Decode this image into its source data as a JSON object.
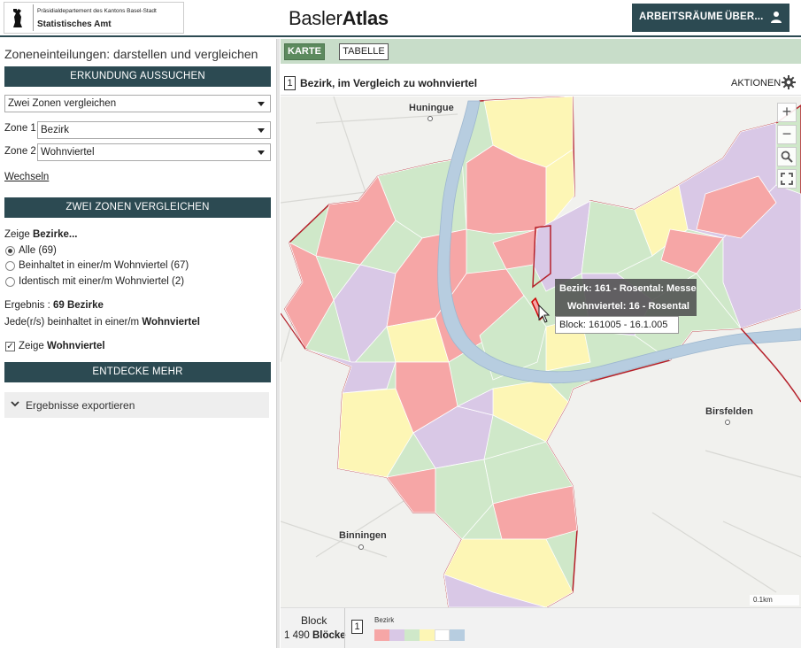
{
  "header": {
    "dept": "Präsidialdepartement des Kantons Basel-Stadt",
    "office": "Statistisches Amt",
    "brand_light": "Basler",
    "brand_bold": "Atlas",
    "nav_workspaces": "ARBEITSRÄUME",
    "nav_about": "ÜBER..."
  },
  "sidebar": {
    "title": "Zoneneinteilungen: darstellen und vergleichen",
    "explore_bar": "ERKUNDUNG AUSSUCHEN",
    "mode_select": "Zwei Zonen vergleichen",
    "zone1_label": "Zone 1",
    "zone1_value": "Bezirk",
    "zone2_label": "Zone 2",
    "zone2_value": "Wohnviertel",
    "swap_link": "Wechseln",
    "compare_bar": "ZWEI ZONEN VERGLEICHEN",
    "show_prefix": "Zeige ",
    "show_bold": "Bezirke...",
    "options": [
      {
        "label": "Alle (69)",
        "selected": true
      },
      {
        "label": "Beinhaltet in einer/m Wohnviertel (67)",
        "selected": false
      },
      {
        "label": "Identisch mit einer/m Wohnviertel (2)",
        "selected": false
      }
    ],
    "result_prefix": "Ergebnis : ",
    "result_bold": "69 Bezirke",
    "each_prefix": "Jede(r/s) beinhaltet in einer/m ",
    "each_bold": "Wohnviertel",
    "show_wohn_prefix": "Zeige ",
    "show_wohn_bold": "Wohnviertel",
    "show_wohn_checked": true,
    "discover_bar": "ENTDECKE MEHR",
    "export_label": "Ergebnisse exportieren"
  },
  "tabs": {
    "map": "KARTE",
    "table": "TABELLE"
  },
  "map_header": {
    "number": "1",
    "title": "Bezirk, im Vergleich zu wohnviertel",
    "actions": "AKTIONEN"
  },
  "map": {
    "places": {
      "huningue": "Huningue",
      "birsfelden": "Birsfelden",
      "binningen": "Binningen"
    },
    "zoom_in": "+",
    "zoom_out": "−",
    "tooltip_bezirk": "Bezirk: 161 - Rosental: Messe",
    "tooltip_wohnviertel": "Wohnviertel: 16 - Rosental",
    "tooltip_block": "Block: 161005 - 16.1.005",
    "scale": "0.1km"
  },
  "footer": {
    "unit_label": "Block",
    "count_number": "1 490",
    "count_bold": "Blöcke",
    "legend_number": "1",
    "legend_title": "Bezirk",
    "swatches": [
      "#f6a6a6",
      "#d9c8e6",
      "#cfe8c9",
      "#fdf6b5",
      "#ffffff",
      "#b7cde0"
    ]
  },
  "colors": {
    "dark_teal": "#2c4a52",
    "map_pink": "#f6a6a6",
    "map_purple": "#d9c8e6",
    "map_green": "#cfe8c9",
    "map_yellow": "#fdf6b5",
    "river": "#b7cde0",
    "border_red": "#b5202a"
  },
  "icons": {
    "user": "user-icon",
    "gear": "gear-icon",
    "search": "search-icon",
    "fullscreen": "fullscreen-icon",
    "chevron": "chevron-down-icon"
  }
}
